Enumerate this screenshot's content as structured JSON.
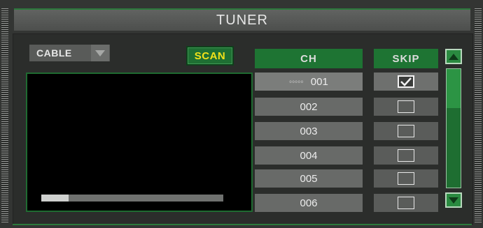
{
  "window": {
    "title": "TUNER"
  },
  "source": {
    "value": "CABLE",
    "arrow_icon": "chevron-down-icon"
  },
  "scan": {
    "label": "SCAN"
  },
  "preview": {
    "progress": 0.15
  },
  "columns": {
    "channel": "CH",
    "skip": "SKIP"
  },
  "channels": [
    {
      "number": "001",
      "signal": "ooooo",
      "skip": true
    },
    {
      "number": "002",
      "skip": false
    },
    {
      "number": "003",
      "skip": false
    },
    {
      "number": "004",
      "skip": false
    },
    {
      "number": "005",
      "skip": false
    },
    {
      "number": "006",
      "skip": false
    }
  ],
  "scrollbar": {
    "up_icon": "arrow-up-icon",
    "down_icon": "arrow-down-icon"
  },
  "colors": {
    "accent_green": "#1e7433",
    "scan_text": "#f2e21a",
    "background": "#333533"
  }
}
